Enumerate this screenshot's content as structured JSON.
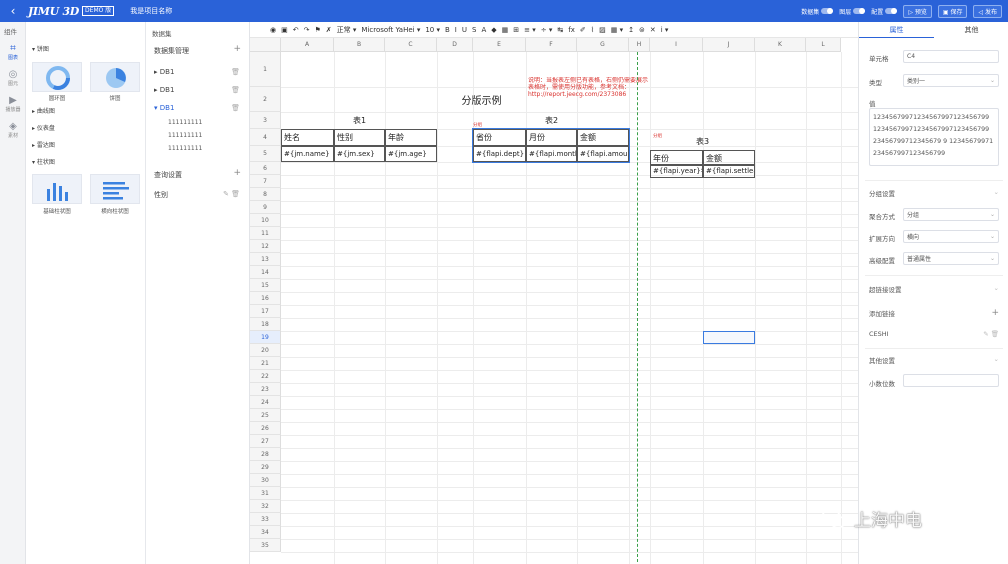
{
  "topbar": {
    "logo": "JIMU 3D",
    "demo_badge": "DEMO 版",
    "project_name": "我是项目名称",
    "toggles": [
      "数据集",
      "图层",
      "配置"
    ],
    "buttons": [
      "预览",
      "保存",
      "发布"
    ]
  },
  "rail": {
    "title": "组件",
    "items": [
      "图表",
      "图元",
      "播放器",
      "素材"
    ]
  },
  "components": {
    "categories": [
      "饼图",
      "曲线图",
      "仪表盘",
      "雷达图",
      "柱状图"
    ],
    "pie_thumbs": [
      "圆环图",
      "饼图"
    ],
    "bar_thumbs": [
      "基础柱状图",
      "横向柱状图"
    ]
  },
  "dataset": {
    "panel_title": "数据集",
    "manage_label": "数据集管理",
    "items": [
      "DB1",
      "DB1",
      "DB1"
    ],
    "fields": [
      "111111111",
      "111111111",
      "111111111"
    ],
    "query_label": "查询设置",
    "query_item": "性别"
  },
  "toolbar": {
    "items": [
      "◉",
      "▣",
      "↶",
      "↷",
      "⚑",
      "✗",
      "正常 ▾",
      "Microsoft YaHei ▾",
      "10 ▾",
      "B",
      "I",
      "U",
      "S",
      "A",
      "◆",
      "▦",
      "⊞",
      "≡ ▾",
      "÷ ▾",
      "↹",
      "fx",
      "✐",
      "⌇",
      "▨",
      "▦ ▾",
      "↥",
      "⊜",
      "✕",
      "i ▾"
    ]
  },
  "sheet": {
    "columns": [
      "A",
      "B",
      "C",
      "D",
      "E",
      "F",
      "G",
      "H",
      "I",
      "J",
      "K",
      "L"
    ],
    "rows": [
      "1",
      "2",
      "3",
      "4",
      "5",
      "6",
      "7",
      "8",
      "9",
      "10",
      "11",
      "12",
      "13",
      "14",
      "15",
      "16",
      "17",
      "18",
      "19",
      "20",
      "21",
      "22",
      "23",
      "24",
      "25",
      "26",
      "27",
      "28",
      "29",
      "30",
      "31",
      "32",
      "33",
      "34",
      "35"
    ],
    "selected_row": "19",
    "title": "分版示例",
    "note": "说明：当报表左侧已有表格，右侧仍需要展示表格时，需使用分版功能，参考文档：http://report.jeecg.com/2373086",
    "group_tag_1": "分组",
    "group_tag_2": "分组",
    "table1": {
      "title": "表1",
      "headers": [
        "姓名",
        "性别",
        "年龄"
      ],
      "values": [
        "#{jm.name}",
        "#{jm.sex}",
        "#{jm.age}"
      ]
    },
    "table2": {
      "title": "表2",
      "headers": [
        "省份",
        "月份",
        "金额"
      ],
      "values": [
        "#{flapi.dept}",
        "#{flapi.month",
        "#{flapi.amount"
      ]
    },
    "table3": {
      "title": "表3",
      "headers": [
        "年份",
        "金额"
      ],
      "values": [
        "#{flapi.year}年",
        "#{flapi.settlea"
      ]
    }
  },
  "props": {
    "tabs": [
      "属性",
      "其他"
    ],
    "cell_label": "单元格",
    "cell_value": "C4",
    "type_label": "类型",
    "type_value": "类别一",
    "value_label": "值",
    "value_text": "12345679971234567997123456799\n12345679971234567997123456799\n23456799712345679 9\n12345679971234567997123456799",
    "group_setting": "分组设置",
    "agg_label": "聚合方式",
    "agg_value": "分组",
    "expand_label": "扩展方向",
    "expand_value": "横向",
    "adv_label": "高级配置",
    "adv_value": "普通属性",
    "link_setting": "超链接设置",
    "add_link": "添加链接",
    "link_item": "CESHI",
    "other_setting": "其他设置",
    "decimal_label": "小数位数"
  },
  "watermark": {
    "text": "上海中电"
  }
}
